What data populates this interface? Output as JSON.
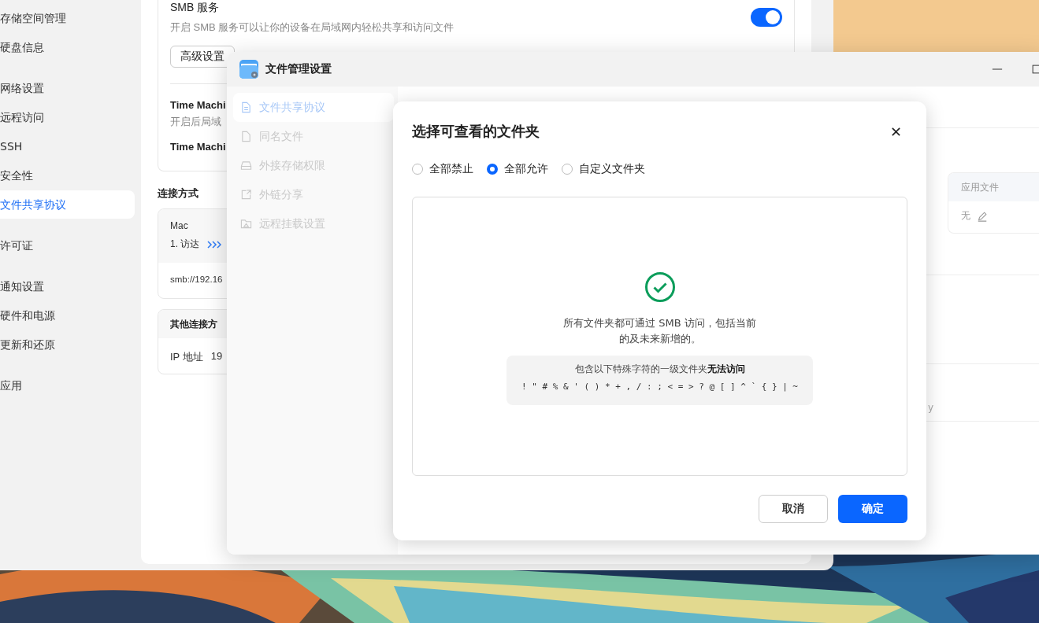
{
  "back_window": {
    "sidebar": [
      {
        "items": [
          {
            "label": "存储空间管理",
            "selected": false
          },
          {
            "label": "硬盘信息",
            "selected": false
          }
        ]
      },
      {
        "items": [
          {
            "label": "网络设置",
            "selected": false
          },
          {
            "label": "远程访问",
            "selected": false
          },
          {
            "label": "SSH",
            "selected": false
          },
          {
            "label": "安全性",
            "selected": false
          },
          {
            "label": "文件共享协议",
            "selected": true
          }
        ]
      },
      {
        "items": [
          {
            "label": "许可证",
            "selected": false
          }
        ]
      },
      {
        "items": [
          {
            "label": "通知设置",
            "selected": false
          },
          {
            "label": "硬件和电源",
            "selected": false
          },
          {
            "label": "更新和还原",
            "selected": false
          }
        ]
      },
      {
        "items": [
          {
            "label": "应用",
            "selected": false
          }
        ]
      }
    ],
    "smb": {
      "title": "SMB 服务",
      "description": "开启 SMB 服务可以让你的设备在局域网内轻松共享和访问文件",
      "on": true,
      "button": "高级设置"
    },
    "time_machine": {
      "title": "Time Machi",
      "description": "开启后局域",
      "title_2": "Time Machi"
    },
    "connection": {
      "heading": "连接方式",
      "mac": {
        "title": "Mac",
        "step": "1. 访达",
        "address": "smb://192.16"
      },
      "other": {
        "title": "其他连接方",
        "label": "IP 地址",
        "value": "19"
      }
    }
  },
  "settings_window": {
    "title": "文件管理设置",
    "nav": [
      {
        "label": "文件共享协议",
        "kind": "document",
        "selected": true
      },
      {
        "label": "同名文件",
        "kind": "file",
        "selected": false
      },
      {
        "label": "外接存储权限",
        "kind": "drive",
        "selected": false
      },
      {
        "label": "外链分享",
        "kind": "share",
        "selected": false
      },
      {
        "label": "远程挂载设置",
        "kind": "folder",
        "selected": false
      }
    ],
    "column_header": "应用文件",
    "column_value": "无",
    "text_fragment": "y"
  },
  "dialog": {
    "title": "选择可查看的文件夹",
    "options": [
      {
        "label": "全部禁止",
        "selected": false
      },
      {
        "label": "全部允许",
        "selected": true
      },
      {
        "label": "自定义文件夹",
        "selected": false
      }
    ],
    "message": [
      "所有文件夹都可通过 SMB 访问，包括当前",
      "的及未来新增的。"
    ],
    "notice": "包含以下特殊字符的一级文件夹**无法访问**",
    "characters": "! \" # % & ' ( ) * + , / : ; < = > ? @ [ ] ^ ` { } | ~",
    "buttons": [
      {
        "label": "取消",
        "kind": "secondary"
      },
      {
        "label": "确定",
        "kind": "primary"
      }
    ]
  }
}
